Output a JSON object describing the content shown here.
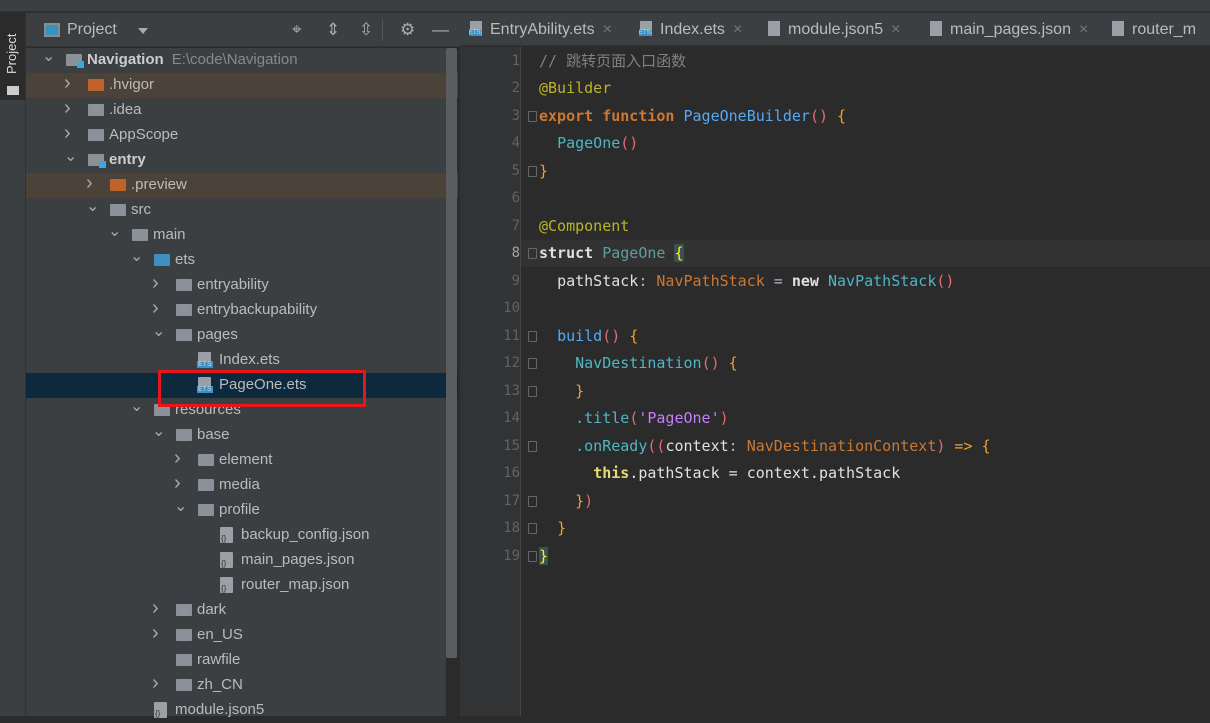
{
  "sidebar_stripe": {
    "label": "Project"
  },
  "project_panel": {
    "title": "Project",
    "tools": [
      "locate-icon",
      "expand-all-icon",
      "collapse-all-icon",
      "gear-icon",
      "minimize-icon"
    ]
  },
  "tree": [
    {
      "name": "Navigation",
      "path": "E:\\code\\Navigation",
      "level": 0,
      "arrow": "expanded",
      "icon": "module",
      "bold": true
    },
    {
      "name": ".hvigor",
      "level": 1,
      "arrow": "collapsed",
      "icon": "orange",
      "hl": true
    },
    {
      "name": ".idea",
      "level": 1,
      "arrow": "collapsed",
      "icon": "folder"
    },
    {
      "name": "AppScope",
      "level": 1,
      "arrow": "collapsed",
      "icon": "folder"
    },
    {
      "name": "entry",
      "level": 1,
      "arrow": "expanded",
      "icon": "module",
      "bold": true
    },
    {
      "name": ".preview",
      "level": 2,
      "arrow": "collapsed",
      "icon": "orange",
      "hl": true
    },
    {
      "name": "src",
      "level": 2,
      "arrow": "expanded",
      "icon": "folder"
    },
    {
      "name": "main",
      "level": 3,
      "arrow": "expanded",
      "icon": "folder"
    },
    {
      "name": "ets",
      "level": 4,
      "arrow": "expanded",
      "icon": "blue"
    },
    {
      "name": "entryability",
      "level": 5,
      "arrow": "collapsed",
      "icon": "folder"
    },
    {
      "name": "entrybackupability",
      "level": 5,
      "arrow": "collapsed",
      "icon": "folder"
    },
    {
      "name": "pages",
      "level": 5,
      "arrow": "expanded",
      "icon": "folder"
    },
    {
      "name": "Index.ets",
      "level": 6,
      "arrow": "none",
      "icon": "ets"
    },
    {
      "name": "PageOne.ets",
      "level": 6,
      "arrow": "none",
      "icon": "ets",
      "selected": true
    },
    {
      "name": "resources",
      "level": 4,
      "arrow": "expanded",
      "icon": "folder"
    },
    {
      "name": "base",
      "level": 5,
      "arrow": "expanded",
      "icon": "folder"
    },
    {
      "name": "element",
      "level": 6,
      "arrow": "collapsed",
      "icon": "folder"
    },
    {
      "name": "media",
      "level": 6,
      "arrow": "collapsed",
      "icon": "folder"
    },
    {
      "name": "profile",
      "level": 6,
      "arrow": "expanded",
      "icon": "folder"
    },
    {
      "name": "backup_config.json",
      "level": 7,
      "arrow": "none",
      "icon": "json"
    },
    {
      "name": "main_pages.json",
      "level": 7,
      "arrow": "none",
      "icon": "json"
    },
    {
      "name": "router_map.json",
      "level": 7,
      "arrow": "none",
      "icon": "json"
    },
    {
      "name": "dark",
      "level": 5,
      "arrow": "collapsed",
      "icon": "folder"
    },
    {
      "name": "en_US",
      "level": 5,
      "arrow": "collapsed",
      "icon": "folder"
    },
    {
      "name": "rawfile",
      "level": 5,
      "arrow": "none",
      "icon": "folder"
    },
    {
      "name": "zh_CN",
      "level": 5,
      "arrow": "collapsed",
      "icon": "folder"
    },
    {
      "name": "module.json5",
      "level": 4,
      "arrow": "none",
      "icon": "json"
    }
  ],
  "editor_tabs": [
    {
      "label": "EntryAbility.ets",
      "icon": "ets",
      "close": "×"
    },
    {
      "label": "Index.ets",
      "icon": "ets",
      "close": "×"
    },
    {
      "label": "module.json5",
      "icon": "json",
      "close": "×"
    },
    {
      "label": "main_pages.json",
      "icon": "json",
      "close": "×"
    },
    {
      "label": "router_m",
      "icon": "json",
      "close": ""
    }
  ],
  "editor": {
    "current_line": 8,
    "lines": [
      [
        [
          "// 跳转页面入口函数",
          "cmt"
        ]
      ],
      [
        [
          "@Builder",
          "ann"
        ]
      ],
      [
        [
          "export ",
          "kw"
        ],
        [
          "function ",
          "kw"
        ],
        [
          "PageOneBuilder",
          "fn"
        ],
        [
          "()",
          "par"
        ],
        [
          " ",
          "p"
        ],
        [
          "{",
          "brc"
        ]
      ],
      [
        [
          "  ",
          "p"
        ],
        [
          "PageOne",
          "cls"
        ],
        [
          "()",
          "par"
        ]
      ],
      [
        [
          "}",
          "brc"
        ]
      ],
      [],
      [
        [
          "@Component",
          "ann"
        ]
      ],
      [
        [
          "struct ",
          "kwp"
        ],
        [
          "PageOne",
          "def"
        ],
        [
          " ",
          "p"
        ],
        [
          "{",
          "caret"
        ]
      ],
      [
        [
          "  ",
          "p"
        ],
        [
          "pathStack",
          "id"
        ],
        [
          ": ",
          "p"
        ],
        [
          "NavPathStack",
          "type"
        ],
        [
          " = ",
          "p"
        ],
        [
          "new ",
          "kwp"
        ],
        [
          "NavPathStack",
          "cls"
        ],
        [
          "()",
          "par"
        ]
      ],
      [],
      [
        [
          "  ",
          "p"
        ],
        [
          "build",
          "fn"
        ],
        [
          "()",
          "par"
        ],
        [
          " ",
          "p"
        ],
        [
          "{",
          "brc"
        ]
      ],
      [
        [
          "    ",
          "p"
        ],
        [
          "NavDestination",
          "cls"
        ],
        [
          "()",
          "par"
        ],
        [
          " ",
          "p"
        ],
        [
          "{",
          "brc"
        ]
      ],
      [
        [
          "    ",
          "p"
        ],
        [
          "}",
          "brc"
        ]
      ],
      [
        [
          "    ",
          "p"
        ],
        [
          ".title",
          "cls"
        ],
        [
          "(",
          "par"
        ],
        [
          "'PageOne'",
          "str"
        ],
        [
          ")",
          "par"
        ]
      ],
      [
        [
          "    ",
          "p"
        ],
        [
          ".onReady",
          "cls"
        ],
        [
          "((",
          "par"
        ],
        [
          "context",
          "id"
        ],
        [
          ": ",
          "p"
        ],
        [
          "NavDestinationContext",
          "type"
        ],
        [
          ")",
          "par"
        ],
        [
          " => ",
          "brc"
        ],
        [
          "{",
          "brc"
        ]
      ],
      [
        [
          "      ",
          "p"
        ],
        [
          "this",
          "this"
        ],
        [
          ".pathStack = context.pathStack",
          "id"
        ]
      ],
      [
        [
          "    ",
          "p"
        ],
        [
          "}",
          "brc"
        ],
        [
          ")",
          "par"
        ]
      ],
      [
        [
          "  ",
          "p"
        ],
        [
          "}",
          "brc"
        ]
      ],
      [
        [
          "}",
          "caret"
        ]
      ]
    ]
  }
}
